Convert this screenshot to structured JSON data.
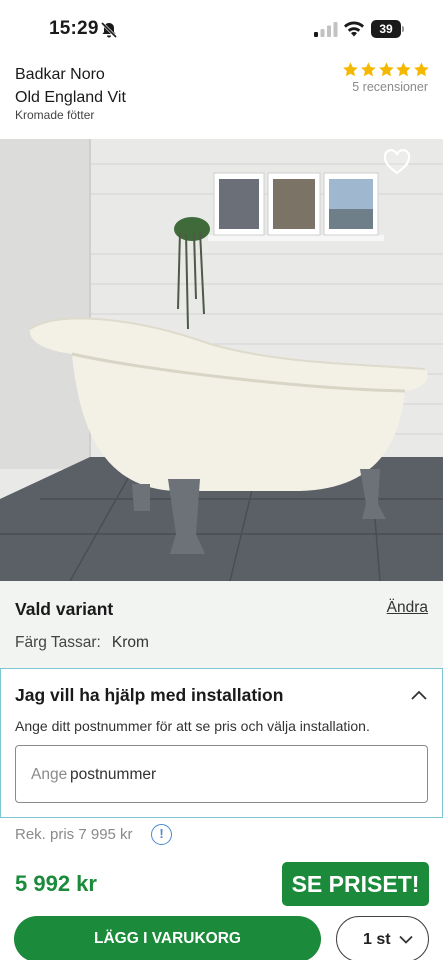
{
  "status_bar": {
    "time": "15:29",
    "battery": "39"
  },
  "product": {
    "name_line1": "Badkar Noro",
    "name_line2": "Old England Vit",
    "subtitle": "Kromade fötter",
    "rating": 5,
    "reviews": "5 recensioner",
    "star_color": "#f5b800",
    "image_icon": "bathtub-photo"
  },
  "variant": {
    "heading": "Vald variant",
    "change_label": "Ändra",
    "attribute_label": "Färg Tassar:",
    "attribute_value": "Krom"
  },
  "installation": {
    "heading": "Jag vill ha hjälp med installation",
    "description": "Ange ditt postnummer för att se pris och välja installation.",
    "input_placeholder_prefix": "Ange",
    "input_placeholder": "postnummer"
  },
  "pricing": {
    "recommended": "Rek. pris 7 995 kr",
    "price": "5 992 kr",
    "see_price_label": "SE PRISET!",
    "accent_color": "#1b8a3a"
  },
  "actions": {
    "add_to_cart": "LÄGG I VARUKORG",
    "quantity": "1 st"
  }
}
